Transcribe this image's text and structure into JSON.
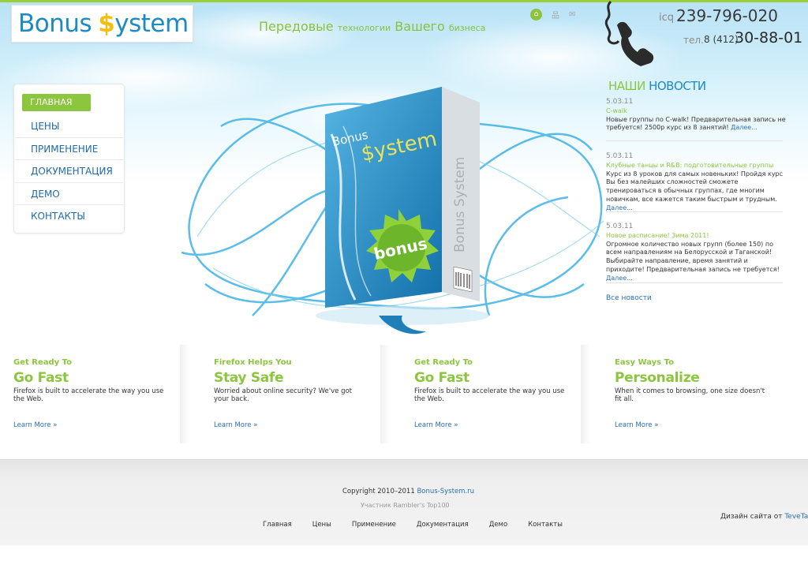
{
  "header": {
    "logo": {
      "part1": "Bonus",
      "part2": "$",
      "part3": "ystem"
    },
    "tagline": {
      "big1": "Передовые",
      "small1": "технологии",
      "big2": "Вашего",
      "small2": "бизнеса"
    },
    "icons": [
      "home-icon",
      "sitemap-icon",
      "mail-icon"
    ],
    "icq_label": "icq",
    "icq_number": "239-796-020",
    "tel_label": "тел.",
    "tel_code": "8 (412)",
    "tel_number": "30-88-01"
  },
  "nav": {
    "items": [
      {
        "label": "ГЛАВНАЯ",
        "active": true
      },
      {
        "label": "ЦЕНЫ",
        "active": false
      },
      {
        "label": "ПРИМЕНЕНИЕ",
        "active": false
      },
      {
        "label": "ДОКУМЕНТАЦИЯ",
        "active": false
      },
      {
        "label": "ДЕМО",
        "active": false
      },
      {
        "label": "КОНТАКТЫ",
        "active": false
      }
    ]
  },
  "product": {
    "box_top": "Bonus",
    "box_system": "$ystem",
    "badge": "bonus",
    "side_text": "Bonus System"
  },
  "news": {
    "title_part1": "НАШИ",
    "title_part2": "НОВОСТИ",
    "items": [
      {
        "date": "5.03.11",
        "headline": "C-walk",
        "text": "Новые группы по C-walk! Предварительная запись не требуется! 2500р курс из 8 занятий!",
        "more": "Далее..."
      },
      {
        "date": "5.03.11",
        "headline": "Клубные танцы и R&B: подготовительные группы",
        "text": "Курс из 8 уроков для самых новеньких! Пройдя курс Вы без малейших сложностей сможете тренироваться в обычных группах, где многим новичкам, все кажется таким быстрым и трудным.",
        "more": "Далее..."
      },
      {
        "date": "5.03.11",
        "headline": "Новое расписание! Зима 2011!",
        "text": "Огромное количество новых групп (более 150) по всем направлениям на Белорусской и Таганской! Выбирайте направление, время занятий и приходите! Предварительная запись не требуется!",
        "more": "Далее..."
      }
    ],
    "all_news": "Все новости"
  },
  "features": [
    {
      "subtitle": "Get Ready To",
      "title": "Go Fast",
      "text": "Firefox is built to accelerate the way you use the Web.",
      "link": "Learn More »"
    },
    {
      "subtitle": "Firefox Helps You",
      "title": "Stay Safe",
      "text": "Worried about online security? We've got your back.",
      "link": "Learn More »"
    },
    {
      "subtitle": "Get Ready To",
      "title": "Go Fast",
      "text": "Firefox is built to accelerate the way you use the Web.",
      "link": "Learn More »"
    },
    {
      "subtitle": "Easy Ways To",
      "title": "Personalize",
      "text": "When it comes to browsing, one size doesn't fit all.",
      "link": "Learn More »"
    }
  ],
  "footer": {
    "copyright": "Copyright 2010–2011",
    "site_link": "Bonus-System.ru",
    "rambler": "Участник Rambler's Top100",
    "nav": [
      "Главная",
      "Цены",
      "Применение",
      "Документация",
      "Демо",
      "Контакты"
    ],
    "design_label": "Дизайн сайта от",
    "design_link": "TeveTazar"
  },
  "colors": {
    "accent_green": "#8cc63e",
    "brand_blue": "#1c8bc4",
    "link_blue": "#2a6fb5",
    "logo_gold": "#f0c018"
  }
}
